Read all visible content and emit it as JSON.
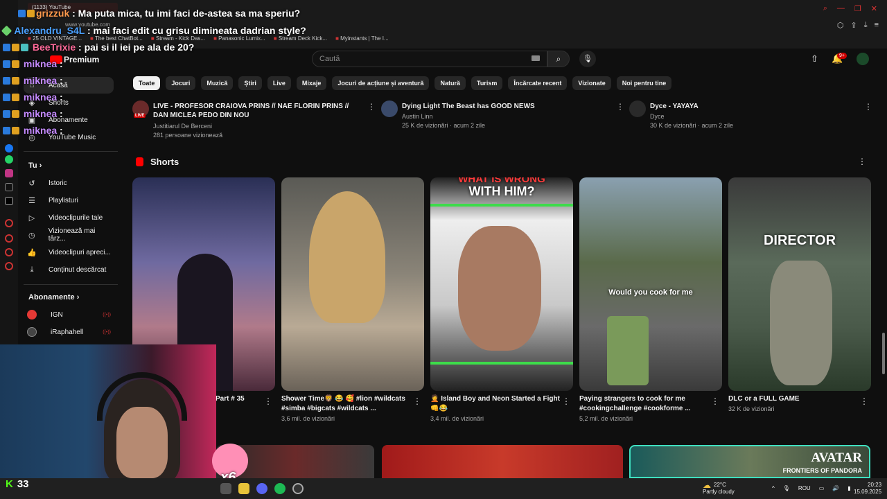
{
  "browser": {
    "tab_title": "(1133) YouTube",
    "url": "www.youtube.com",
    "bookmarks": [
      "25 OLD VINTAGE...",
      "The best ChatBot...",
      "Stream - Kick Das...",
      "Panasonic Lumix...",
      "Stream Deck Kick...",
      "Myinstants | The I..."
    ]
  },
  "chat": [
    {
      "user": "grizzuk",
      "message": ": Ma puta mica, tu imi faci de-astea sa ma speriu?",
      "color": "#ff4d4d"
    },
    {
      "user": "Alexandru_S4L",
      "message": ": mai faci edit cu grisu dimineata dadrian style?",
      "color": "#3aa0ff"
    },
    {
      "user": "BeeTrixie",
      "message": ": pai si il iei pe ala de 20?",
      "color": "#ff5fa0"
    },
    {
      "user": "miknea",
      "message": ":",
      "color": "#b784ff"
    },
    {
      "user": "miknea",
      "message": ":",
      "color": "#b784ff"
    },
    {
      "user": "miknea",
      "message": ":",
      "color": "#b784ff"
    },
    {
      "user": "miknea",
      "message": ":",
      "color": "#b784ff"
    },
    {
      "user": "miknea",
      "message": ":",
      "color": "#b784ff"
    }
  ],
  "header": {
    "logo_label": "Premium",
    "search_placeholder": "Caută",
    "notifications_count": "9+"
  },
  "sidebar": {
    "main_items": [
      {
        "label": "Acasă",
        "icon": "home-icon"
      },
      {
        "label": "Shorts",
        "icon": "shorts-icon"
      },
      {
        "label": "Abonamente",
        "icon": "subscriptions-icon"
      },
      {
        "label": "YouTube Music",
        "icon": "music-icon"
      }
    ],
    "you_section": "Tu",
    "you_items": [
      {
        "label": "Istoric",
        "icon": "history-icon"
      },
      {
        "label": "Playlisturi",
        "icon": "playlist-icon"
      },
      {
        "label": "Videoclipurile tale",
        "icon": "your-videos-icon"
      },
      {
        "label": "Vizionează mai târz...",
        "icon": "watch-later-icon"
      },
      {
        "label": "Videoclipuri apreci...",
        "icon": "like-icon"
      },
      {
        "label": "Conținut descărcat",
        "icon": "download-icon"
      }
    ],
    "subs_section": "Abonamente",
    "subs_items": [
      {
        "label": "IGN",
        "color": "#e53935"
      },
      {
        "label": "iRaphahell",
        "color": "#444444"
      }
    ]
  },
  "chips": [
    "Toate",
    "Jocuri",
    "Muzică",
    "Știri",
    "Live",
    "Mixaje",
    "Jocuri de acțiune și aventură",
    "Natură",
    "Turism",
    "Încărcate recent",
    "Vizionate",
    "Noi pentru tine"
  ],
  "top_videos": [
    {
      "title": "LIVE - PROFESOR CRAIOVA PRINS // NAE FLORIN PRINS // DAN MICLEA PEDO DIN NOU",
      "channel": "Justitiarul De Berceni",
      "stats": "281 persoane vizionează",
      "live_tag": "LIVE"
    },
    {
      "title": "Dying Light The Beast has GOOD NEWS",
      "channel": "Austin Linn",
      "stats": "25 K de vizionări · acum 2 zile"
    },
    {
      "title": "Dyce - YAYAYA",
      "channel": "Dyce",
      "stats": "30 K de vizionări · acum 2 zile"
    }
  ],
  "shorts": {
    "title": "Shorts",
    "items": [
      {
        "title": "Part # 35",
        "views": ""
      },
      {
        "title": "Shower Time🦁 😂 🥰 #lion #wildcats #simba #bigcats #wildcats ...",
        "views": "3,6 mil. de vizionări"
      },
      {
        "title": "🤦 Island Boy and Neon Started a Fight 👊😂",
        "views": "3,4 mil. de vizionări",
        "overlay_top": "WHAT IS WRONG",
        "overlay_top2": "WITH HIM?"
      },
      {
        "title": "Paying strangers to cook for me #cookingchallenge #cookforme ...",
        "views": "5,2 mil. de vizionări",
        "overlay": "Would you cook for me"
      },
      {
        "title": "DLC or a FULL GAME",
        "views": "32 K de vizionări",
        "overlay": "DIRECTOR"
      }
    ]
  },
  "bottom_thumbs": {
    "avatar_title": "AVATAR",
    "avatar_sub": "FRONTIERS OF PANDORA",
    "multiplier": "x6"
  },
  "kick_viewers": "33",
  "taskbar": {
    "temperature": "22°C",
    "weather": "Partly cloudy",
    "language": "ROU",
    "time": "20:23",
    "date": "15.09.2025"
  }
}
